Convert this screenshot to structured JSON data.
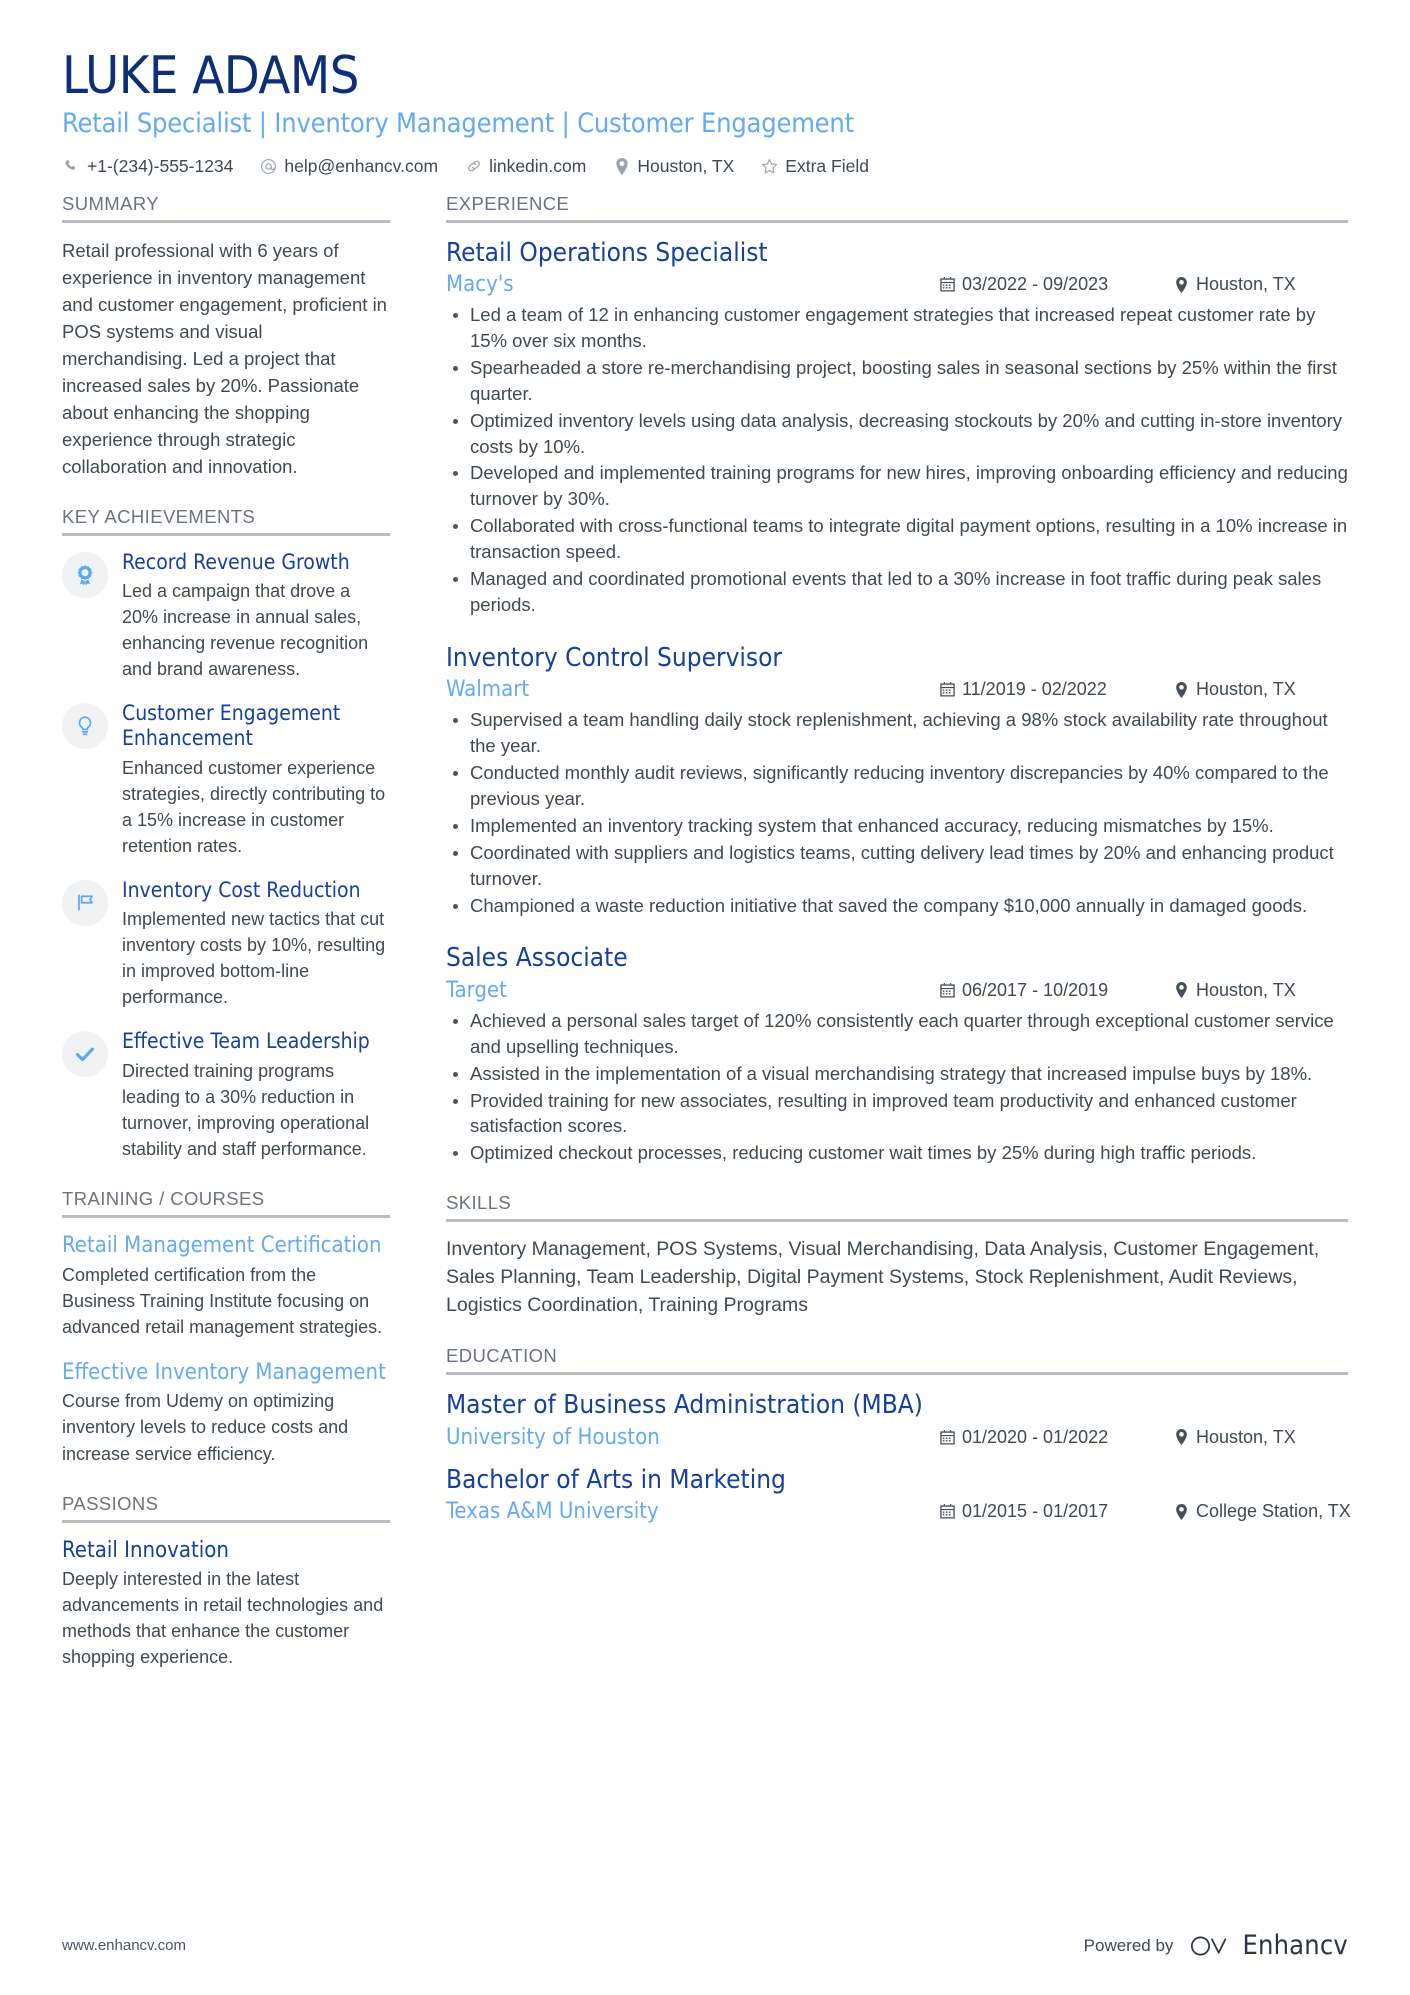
{
  "header": {
    "name": "LUKE ADAMS",
    "tagline": "Retail Specialist | Inventory Management | Customer Engagement",
    "contacts": [
      {
        "icon": "phone-icon",
        "text": "+1-(234)-555-1234"
      },
      {
        "icon": "email-icon",
        "text": "help@enhancv.com"
      },
      {
        "icon": "link-icon",
        "text": "linkedin.com"
      },
      {
        "icon": "location-pin-icon",
        "text": "Houston, TX"
      },
      {
        "icon": "star-icon",
        "text": "Extra Field"
      }
    ]
  },
  "left": {
    "summary": {
      "heading": "SUMMARY",
      "text": "Retail professional with 6 years of experience in inventory management and customer engagement, proficient in POS systems and visual merchandising. Led a project that increased sales by 20%. Passionate about enhancing the shopping experience through strategic collaboration and innovation."
    },
    "key_achievements": {
      "heading": "KEY ACHIEVEMENTS",
      "items": [
        {
          "icon": "award-ribbon-icon",
          "title": "Record Revenue Growth",
          "description": "Led a campaign that drove a 20% increase in annual sales, enhancing revenue recognition and brand awareness."
        },
        {
          "icon": "lightbulb-icon",
          "title": "Customer Engagement Enhancement",
          "description": "Enhanced customer experience strategies, directly contributing to a 15% increase in customer retention rates."
        },
        {
          "icon": "flag-icon",
          "title": "Inventory Cost Reduction",
          "description": "Implemented new tactics that cut inventory costs by 10%, resulting in improved bottom-line performance."
        },
        {
          "icon": "check-icon",
          "title": "Effective Team Leadership",
          "description": "Directed training programs leading to a 30% reduction in turnover, improving operational stability and staff performance."
        }
      ]
    },
    "training": {
      "heading": "TRAINING / COURSES",
      "items": [
        {
          "title": "Retail Management Certification",
          "description": "Completed certification from the Business Training Institute focusing on advanced retail management strategies."
        },
        {
          "title": "Effective Inventory Management",
          "description": "Course from Udemy on optimizing inventory levels to reduce costs and increase service efficiency."
        }
      ]
    },
    "passions": {
      "heading": "PASSIONS",
      "items": [
        {
          "title": "Retail Innovation",
          "description": "Deeply interested in the latest advancements in retail technologies and methods that enhance the customer shopping experience."
        }
      ]
    }
  },
  "right": {
    "experience": {
      "heading": "EXPERIENCE",
      "jobs": [
        {
          "title": "Retail Operations Specialist",
          "company": "Macy's",
          "dates": "03/2022 - 09/2023",
          "location": "Houston, TX",
          "bullets": [
            "Led a team of 12 in enhancing customer engagement strategies that increased repeat customer rate by 15% over six months.",
            "Spearheaded a store re-merchandising project, boosting sales in seasonal sections by 25% within the first quarter.",
            "Optimized inventory levels using data analysis, decreasing stockouts by 20% and cutting in-store inventory costs by 10%.",
            "Developed and implemented training programs for new hires, improving onboarding efficiency and reducing turnover by 30%.",
            "Collaborated with cross-functional teams to integrate digital payment options, resulting in a 10% increase in transaction speed.",
            "Managed and coordinated promotional events that led to a 30% increase in foot traffic during peak sales periods."
          ]
        },
        {
          "title": "Inventory Control Supervisor",
          "company": "Walmart",
          "dates": "11/2019 - 02/2022",
          "location": "Houston, TX",
          "bullets": [
            "Supervised a team handling daily stock replenishment, achieving a 98% stock availability rate throughout the year.",
            "Conducted monthly audit reviews, significantly reducing inventory discrepancies by 40% compared to the previous year.",
            "Implemented an inventory tracking system that enhanced accuracy, reducing mismatches by 15%.",
            "Coordinated with suppliers and logistics teams, cutting delivery lead times by 20% and enhancing product turnover.",
            "Championed a waste reduction initiative that saved the company $10,000 annually in damaged goods."
          ]
        },
        {
          "title": "Sales Associate",
          "company": "Target",
          "dates": "06/2017 - 10/2019",
          "location": "Houston, TX",
          "bullets": [
            "Achieved a personal sales target of 120% consistently each quarter through exceptional customer service and upselling techniques.",
            "Assisted in the implementation of a visual merchandising strategy that increased impulse buys by 18%.",
            "Provided training for new associates, resulting in improved team productivity and enhanced customer satisfaction scores.",
            "Optimized checkout processes, reducing customer wait times by 25% during high traffic periods."
          ]
        }
      ]
    },
    "skills": {
      "heading": "SKILLS",
      "text": "Inventory Management, POS Systems, Visual Merchandising, Data Analysis, Customer Engagement, Sales Planning, Team Leadership, Digital Payment Systems, Stock Replenishment, Audit Reviews, Logistics Coordination, Training Programs"
    },
    "education": {
      "heading": "EDUCATION",
      "items": [
        {
          "degree": "Master of Business Administration (MBA)",
          "school": "University of Houston",
          "dates": "01/2020 - 01/2022",
          "location": "Houston, TX"
        },
        {
          "degree": "Bachelor of Arts in Marketing",
          "school": "Texas A&M University",
          "dates": "01/2015 - 01/2017",
          "location": "College Station, TX"
        }
      ]
    }
  },
  "footer": {
    "url": "www.enhancv.com",
    "powered_by": "Powered by",
    "brand": "Enhancv"
  },
  "colors": {
    "name_navy": "#0e2f75",
    "heading_navy": "#16409b",
    "accent_blue": "#64aaf0",
    "body_gray": "#3f4954",
    "rule_gray": "#b9bdc3"
  }
}
